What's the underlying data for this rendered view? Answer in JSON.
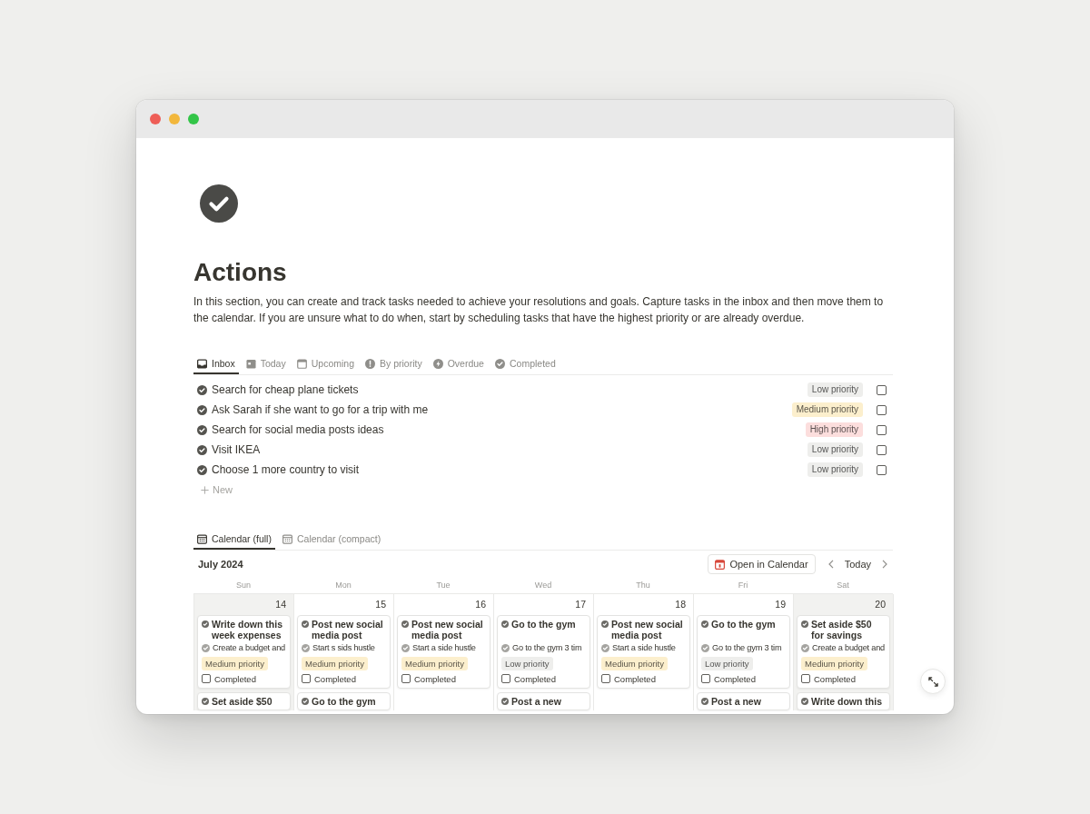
{
  "page": {
    "title": "Actions",
    "description": "In this section, you can create and track tasks needed to achieve your resolutions and goals. Capture tasks in the inbox and then move them to the calendar. If you are unsure what to do when, start by scheduling tasks that have the highest priority or are already overdue."
  },
  "inbox": {
    "tabs": [
      {
        "label": "Inbox",
        "selected": true
      },
      {
        "label": "Today",
        "selected": false
      },
      {
        "label": "Upcoming",
        "selected": false
      },
      {
        "label": "By priority",
        "selected": false
      },
      {
        "label": "Overdue",
        "selected": false
      },
      {
        "label": "Completed",
        "selected": false
      }
    ],
    "tasks": [
      {
        "title": "Search for cheap plane tickets",
        "priority": {
          "label": "Low priority",
          "color": "#eeeeec"
        },
        "checked": false
      },
      {
        "title": "Ask Sarah if she want to go for a trip with me",
        "priority": {
          "label": "Medium priority",
          "color": "#fcefcd"
        },
        "checked": false
      },
      {
        "title": "Search for social media posts ideas",
        "priority": {
          "label": "High priority",
          "color": "#fcdedd"
        },
        "checked": false
      },
      {
        "title": "Visit IKEA",
        "priority": {
          "label": "Low priority",
          "color": "#eeeeec"
        },
        "checked": false
      },
      {
        "title": "Choose 1 more country to visit",
        "priority": {
          "label": "Low priority",
          "color": "#eeeeec"
        },
        "checked": false
      }
    ],
    "new_label": "New"
  },
  "calendar": {
    "tabs": [
      {
        "label": "Calendar (full)",
        "selected": true
      },
      {
        "label": "Calendar (compact)",
        "selected": false
      }
    ],
    "month": "July 2024",
    "open_button": "Open in Calendar",
    "today_button": "Today",
    "days": [
      {
        "weekday": "Sun",
        "date": "14",
        "weekend": true,
        "cards": [
          {
            "title": "Write down this week expenses",
            "relation": "Create a budget and",
            "priority": {
              "label": "Medium priority",
              "color": "#fcefcd"
            },
            "checkbox": {
              "label": "Completed",
              "checked": false
            }
          },
          {
            "title": "Set aside $50"
          }
        ]
      },
      {
        "weekday": "Mon",
        "date": "15",
        "weekend": false,
        "cards": [
          {
            "title": "Post new social media post",
            "relation": "Start s sids hustle",
            "priority": {
              "label": "Medium priority",
              "color": "#fcefcd"
            },
            "checkbox": {
              "label": "Completed",
              "checked": false
            }
          },
          {
            "title": "Go to the gym"
          }
        ]
      },
      {
        "weekday": "Tue",
        "date": "16",
        "weekend": false,
        "cards": [
          {
            "title": "Post new social media post",
            "relation": "Start a side hustle",
            "priority": {
              "label": "Medium priority",
              "color": "#fcefcd"
            },
            "checkbox": {
              "label": "Completed",
              "checked": false
            }
          }
        ]
      },
      {
        "weekday": "Wed",
        "date": "17",
        "weekend": false,
        "cards": [
          {
            "title": "Go to the gym",
            "relation": "Go to the gym 3 tim",
            "priority": {
              "label": "Low priority",
              "color": "#eeeeec"
            },
            "checkbox": {
              "label": "Completed",
              "checked": false
            }
          },
          {
            "title": "Post a new"
          }
        ]
      },
      {
        "weekday": "Thu",
        "date": "18",
        "weekend": false,
        "cards": [
          {
            "title": "Post new social media post",
            "relation": "Start a side hustle",
            "priority": {
              "label": "Medium priority",
              "color": "#fcefcd"
            },
            "checkbox": {
              "label": "Completed",
              "checked": false
            }
          }
        ]
      },
      {
        "weekday": "Fri",
        "date": "19",
        "weekend": false,
        "cards": [
          {
            "title": "Go to the gym",
            "relation": "Go to the gym 3 tim",
            "priority": {
              "label": "Low priority",
              "color": "#eeeeec"
            },
            "checkbox": {
              "label": "Completed",
              "checked": false
            }
          },
          {
            "title": "Post a new"
          }
        ]
      },
      {
        "weekday": "Sat",
        "date": "20",
        "weekend": true,
        "cards": [
          {
            "title": "Set aside $50 for savings",
            "relation": "Create a budget and",
            "priority": {
              "label": "Medium priority",
              "color": "#fcefcd"
            },
            "checkbox": {
              "label": "Completed",
              "checked": false
            }
          },
          {
            "title": "Write down this"
          }
        ]
      }
    ]
  }
}
